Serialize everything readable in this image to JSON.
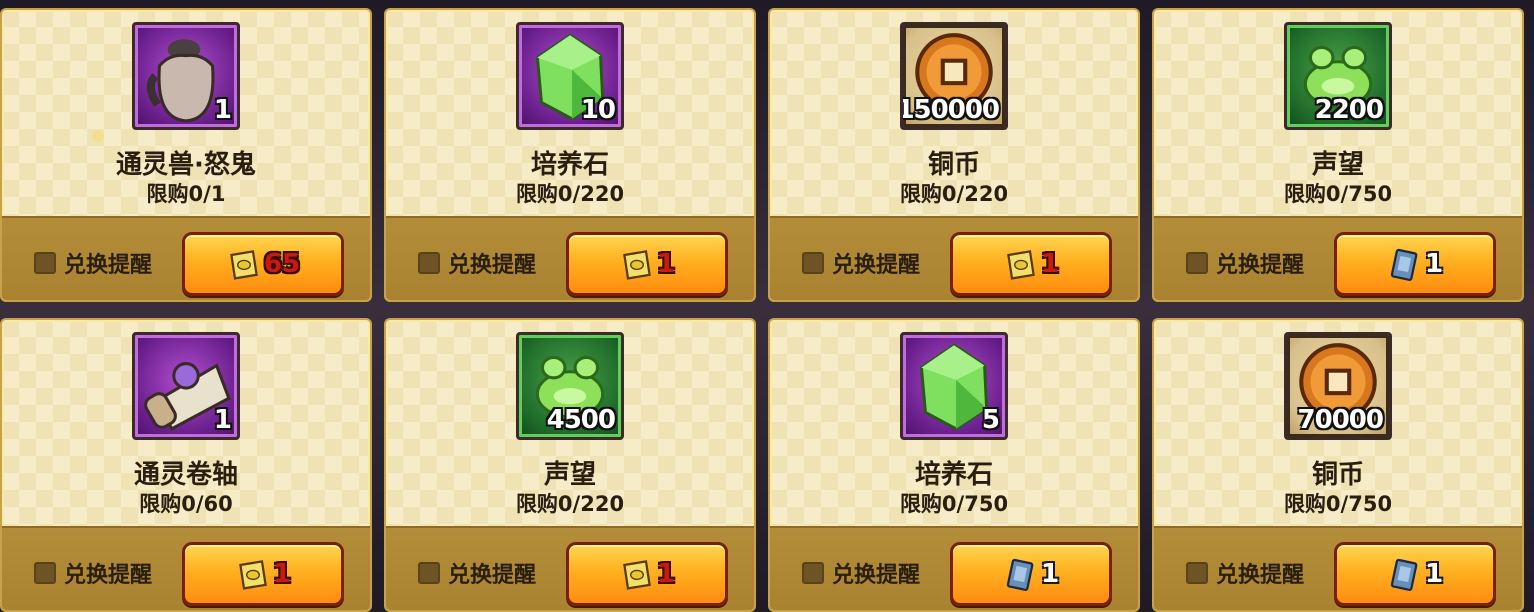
{
  "reminder_label": "兑换提醒",
  "items": [
    {
      "name": "通灵兽·怒鬼",
      "qty": "1",
      "limit": "限购0/1",
      "frame": "purple",
      "icon": "summon-beast-bag-icon",
      "cost": "65",
      "cost_icon": "yellow-token-icon",
      "cost_color": "red"
    },
    {
      "name": "培养石",
      "qty": "10",
      "limit": "限购0/220",
      "frame": "purple",
      "icon": "green-gem-icon",
      "cost": "1",
      "cost_icon": "yellow-token-icon",
      "cost_color": "red"
    },
    {
      "name": "铜币",
      "qty": "150000",
      "limit": "限购0/220",
      "frame": "brown",
      "icon": "copper-coin-icon",
      "cost": "1",
      "cost_icon": "yellow-token-icon",
      "cost_color": "red"
    },
    {
      "name": "声望",
      "qty": "2200",
      "limit": "限购0/750",
      "frame": "green",
      "icon": "prestige-toad-icon",
      "cost": "1",
      "cost_icon": "blue-card-icon",
      "cost_color": "white"
    },
    {
      "name": "通灵卷轴",
      "qty": "1",
      "limit": "限购0/60",
      "frame": "purple",
      "icon": "summon-scroll-icon",
      "cost": "1",
      "cost_icon": "yellow-token-icon",
      "cost_color": "red"
    },
    {
      "name": "声望",
      "qty": "4500",
      "limit": "限购0/220",
      "frame": "green",
      "icon": "prestige-toad-icon",
      "cost": "1",
      "cost_icon": "yellow-token-icon",
      "cost_color": "red"
    },
    {
      "name": "培养石",
      "qty": "5",
      "limit": "限购0/750",
      "frame": "purple",
      "icon": "green-gem-icon",
      "cost": "1",
      "cost_icon": "blue-card-icon",
      "cost_color": "white"
    },
    {
      "name": "铜币",
      "qty": "70000",
      "limit": "限购0/750",
      "frame": "brown",
      "icon": "copper-coin-icon",
      "cost": "1",
      "cost_icon": "blue-card-icon",
      "cost_color": "white"
    }
  ]
}
